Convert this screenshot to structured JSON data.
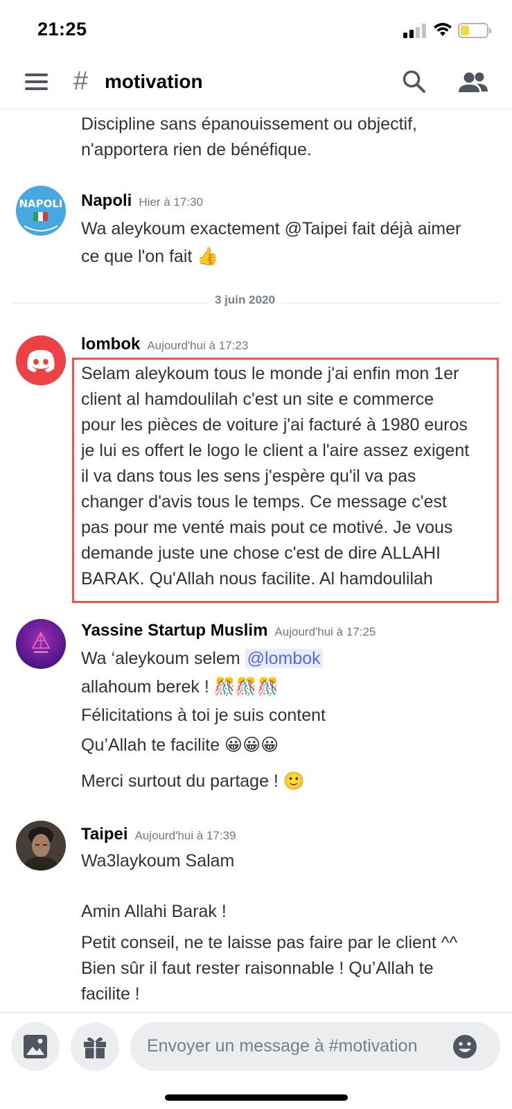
{
  "status_bar": {
    "time": "21:25"
  },
  "header": {
    "hash": "#",
    "channel": "motivation"
  },
  "messages": [
    {
      "author": "",
      "time": "",
      "lines": [
        "Discipline sans épanouissement ou objectif,",
        "n'apportera rien de bénéfique."
      ]
    },
    {
      "author": "Napoli",
      "time": "Hier à 17:30",
      "avatar_text": "NAPOLI",
      "lines": [
        "Wa aleykoum exactement @Taipei fait déjà aimer",
        "ce que l'on fait 👍"
      ]
    },
    {
      "author": "lombok",
      "time": "Aujourd'hui à 17:23",
      "lines": [
        "Selam aleykoum tous le monde j'ai enfin mon 1er",
        "client al hamdoulilah c'est un site e commerce",
        "pour les pièces de voiture j'ai facturé à 1980 euros",
        "je lui es offert le logo le client a l'aire assez exigent",
        "il va dans tous les sens j'espère qu'il va pas",
        "changer d'avis tous le temps. Ce message c'est",
        "pas pour me venté mais pout ce motivé. Je vous",
        "demande juste une chose c'est de dire ALLAHI",
        "BARAK. Qu'Allah nous facilite. Al hamdoulilah"
      ]
    },
    {
      "author": "Yassine Startup Muslim",
      "time": "Aujourd'hui à 17:25",
      "line1_prefix": "Wa ‘aleykoum selem ",
      "mention": "@lombok",
      "lines": [
        "allahoum berek ! 🎊🎊🎊",
        "Félicitations à toi je suis content",
        "Qu’Allah te facilite 😀😀😀",
        "Merci surtout du partage ! 🙂"
      ]
    },
    {
      "author": "Taipei",
      "time": "Aujourd'hui à 17:39",
      "lines": [
        "Wa3laykoum Salam",
        "Amin Allahi Barak !",
        "Petit conseil, ne te laisse pas faire par le client ^^",
        "Bien sûr il faut rester raisonnable ! Qu’Allah te",
        "facilite !"
      ]
    }
  ],
  "date_divider": "3 juin 2020",
  "input": {
    "placeholder": "Envoyer un message à #motivation"
  },
  "colors": {
    "accent": "#5865f2",
    "highlight": "#e8564e",
    "discord_red": "#ed4245"
  }
}
